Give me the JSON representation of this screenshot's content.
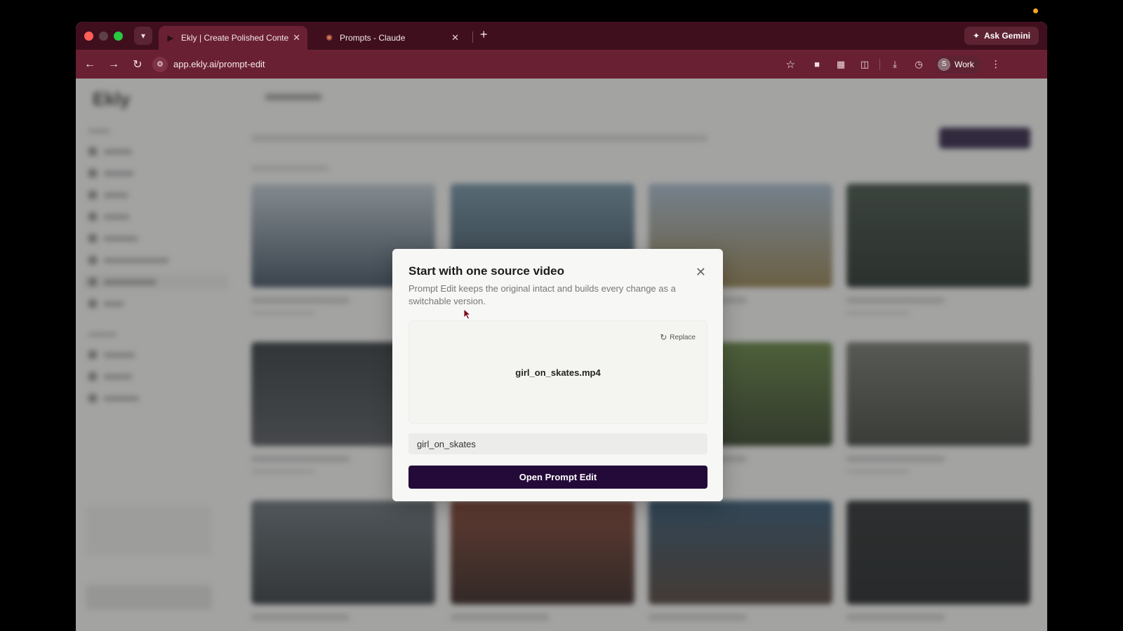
{
  "browser": {
    "tabs": [
      {
        "title": "Ekly | Create Polished Content",
        "active": true
      },
      {
        "title": "Prompts - Claude",
        "active": false
      }
    ],
    "new_tab": "+",
    "ask_gemini": "Ask Gemini",
    "url": "app.ekly.ai/prompt-edit",
    "profile": {
      "initial": "S",
      "name": "Work"
    }
  },
  "background_app": {
    "logo": "Ekly"
  },
  "modal": {
    "title": "Start with one source video",
    "description": "Prompt Edit keeps the original intact and builds every change as a switchable version.",
    "file_name": "girl_on_skates.mp4",
    "replace_label": "Replace",
    "name_value": "girl_on_skates",
    "primary_button": "Open Prompt Edit"
  },
  "colors": {
    "chrome_dark": "#3f0f1e",
    "chrome": "#6a2033",
    "primary_button": "#240a39"
  }
}
